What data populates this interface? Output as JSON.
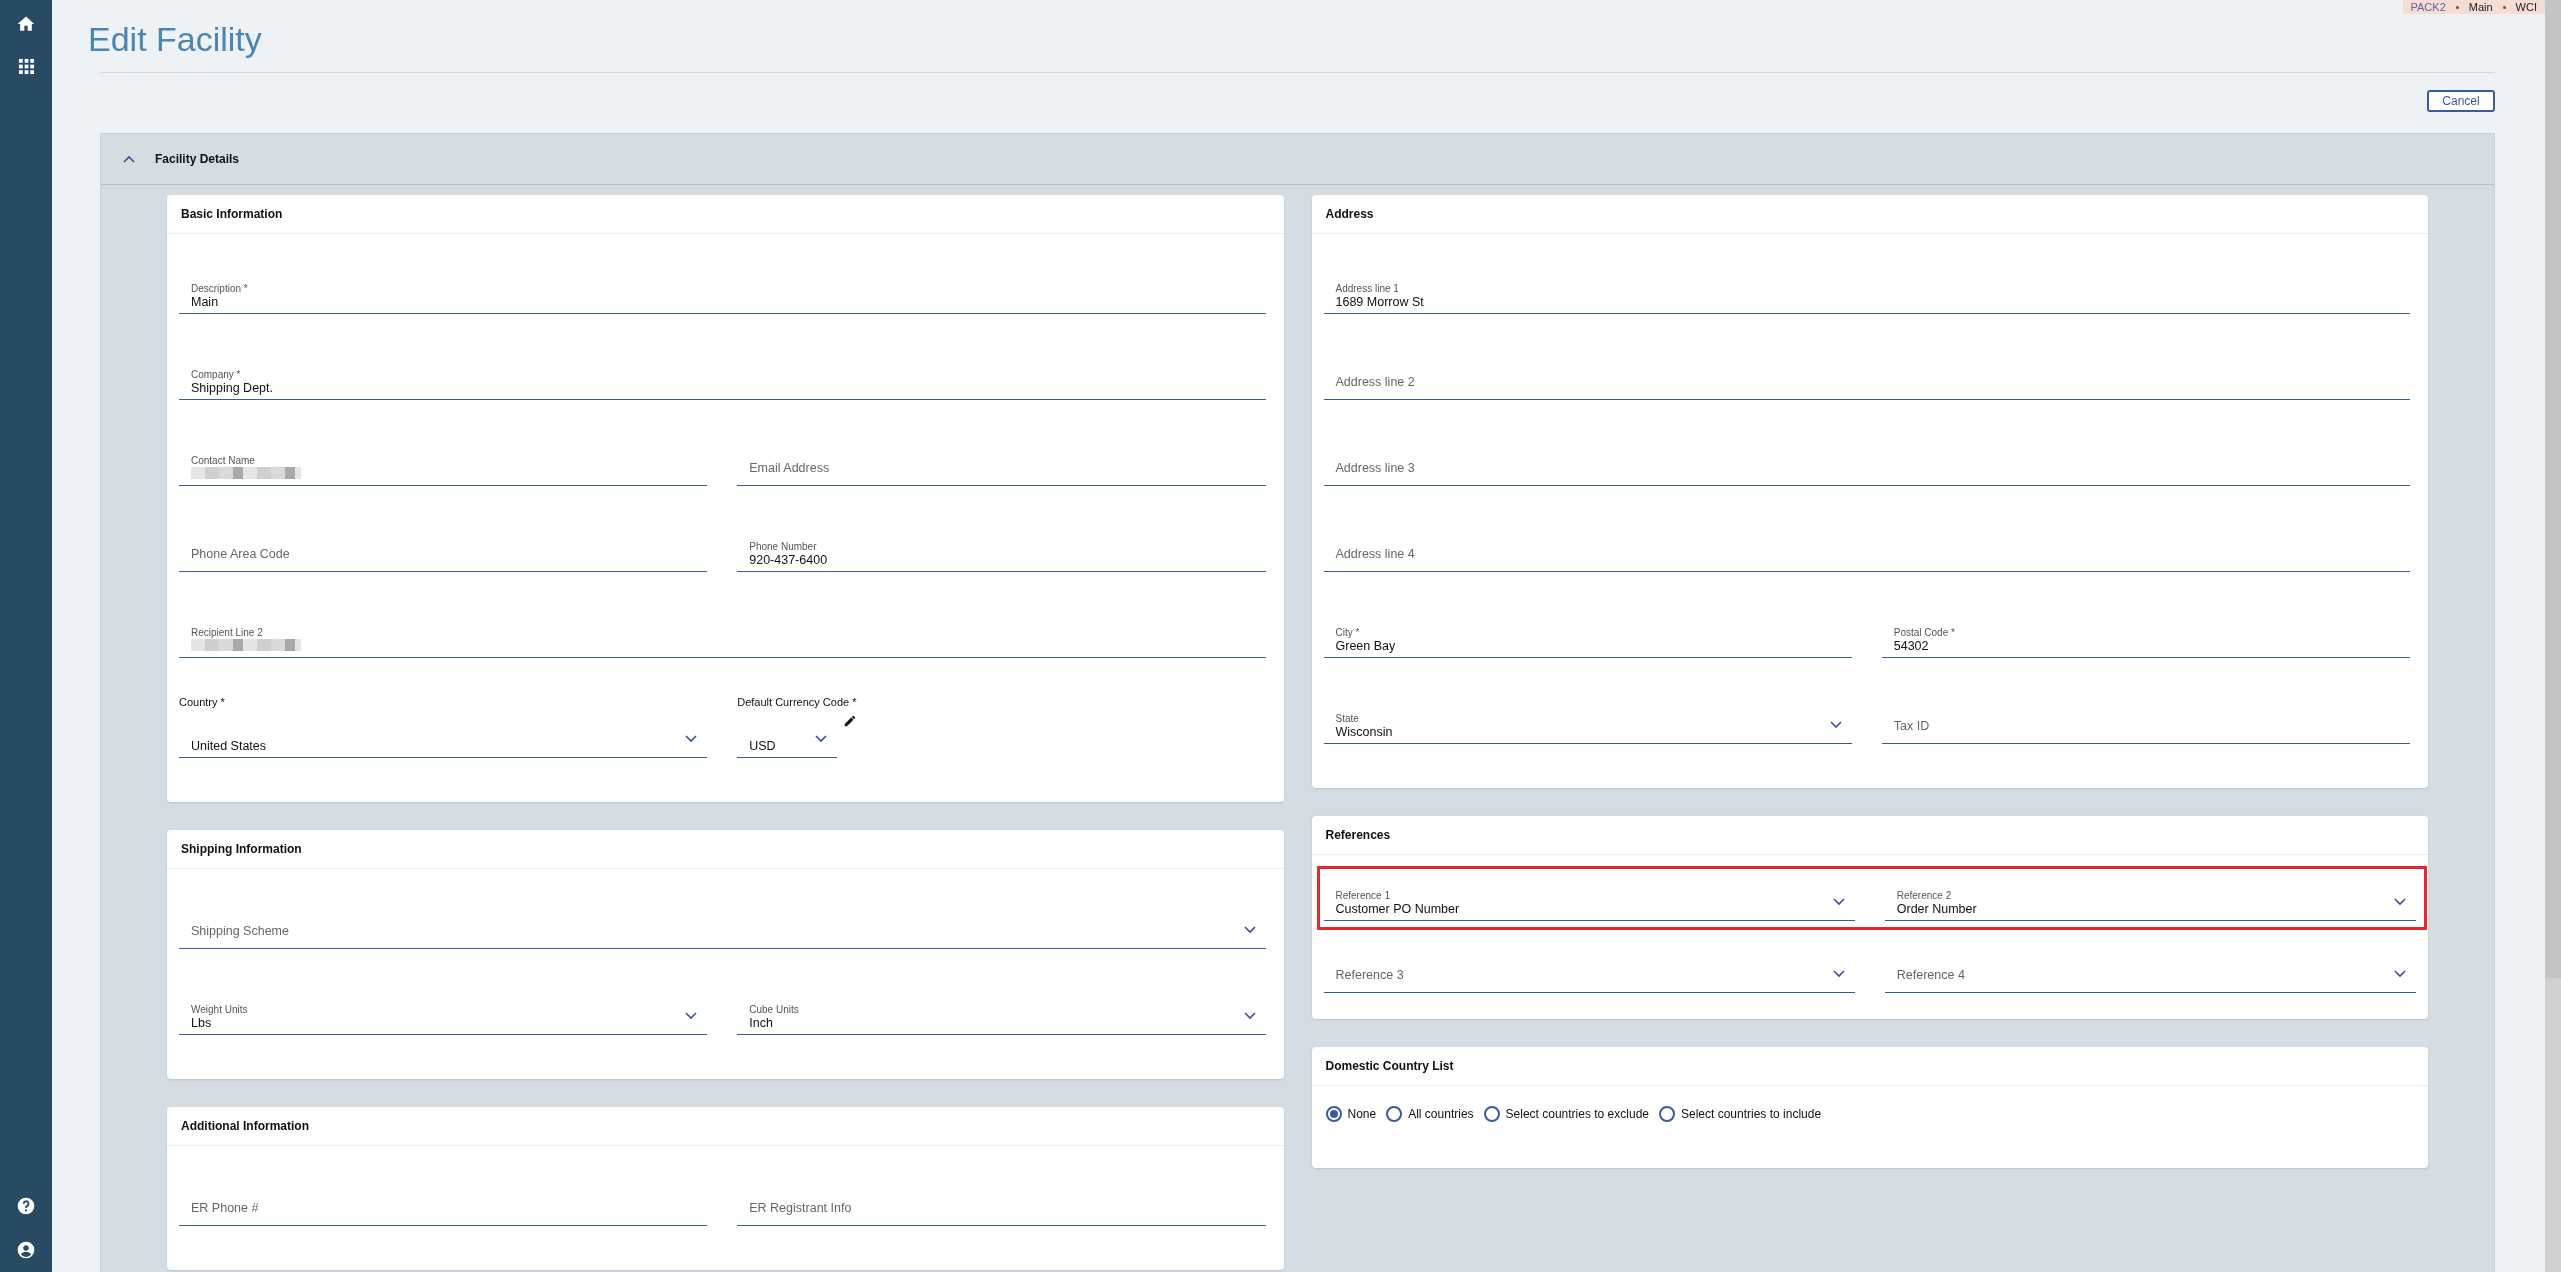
{
  "context": [
    "PACK2",
    "Main",
    "WCI"
  ],
  "page": {
    "title": "Edit Facility",
    "cancel": "Cancel"
  },
  "panel": {
    "title": "Facility Details",
    "expanded": true
  },
  "left_cards": [
    {
      "title": "Basic Information",
      "rows": [
        [
          {
            "kind": "text",
            "label": "Description *",
            "value": "Main"
          }
        ],
        [
          {
            "kind": "text",
            "label": "Company *",
            "value": "Shipping Dept."
          }
        ],
        [
          {
            "kind": "text",
            "label": "Contact Name",
            "redacted": true
          },
          {
            "kind": "text",
            "placeholder": "Email Address"
          }
        ],
        [
          {
            "kind": "text",
            "placeholder": "Phone Area Code"
          },
          {
            "kind": "text",
            "label": "Phone Number",
            "value": "920-437-6400"
          }
        ],
        [
          {
            "kind": "text",
            "label": "Recipient Line 2",
            "redacted": true
          }
        ],
        [
          {
            "kind": "outside-select",
            "label": "Country *",
            "value": "United States"
          },
          {
            "kind": "short-select",
            "label": "Default Currency Code *",
            "value": "USD",
            "editable": true
          }
        ]
      ]
    },
    {
      "title": "Shipping Information",
      "rows": [
        [
          {
            "kind": "select",
            "placeholder": "Shipping Scheme"
          }
        ],
        [
          {
            "kind": "select",
            "label": "Weight Units",
            "value": "Lbs"
          },
          {
            "kind": "select",
            "label": "Cube Units",
            "value": "Inch"
          }
        ]
      ]
    },
    {
      "title": "Additional Information",
      "rows": [
        [
          {
            "kind": "text",
            "placeholder": "ER Phone #"
          },
          {
            "kind": "text",
            "placeholder": "ER Registrant Info"
          }
        ]
      ]
    }
  ],
  "right_cards": [
    {
      "title": "Address",
      "rows": [
        [
          {
            "kind": "text",
            "label": "Address line 1",
            "value": "1689 Morrow St"
          }
        ],
        [
          {
            "kind": "text",
            "placeholder": "Address line 2"
          }
        ],
        [
          {
            "kind": "text",
            "placeholder": "Address line 3"
          }
        ],
        [
          {
            "kind": "text",
            "placeholder": "Address line 4"
          }
        ],
        [
          {
            "kind": "text",
            "label": "City *",
            "value": "Green Bay"
          },
          {
            "kind": "text",
            "label": "Postal Code *",
            "value": "54302"
          }
        ],
        [
          {
            "kind": "select",
            "label": "State",
            "value": "Wisconsin"
          },
          {
            "kind": "text",
            "placeholder": "Tax ID"
          }
        ]
      ]
    },
    {
      "title": "References",
      "tight": true,
      "rows": [
        [
          {
            "kind": "select",
            "label": "Reference 1",
            "value": "Customer PO Number"
          },
          {
            "kind": "select",
            "label": "Reference 2",
            "value": "Order Number"
          }
        ],
        [
          {
            "kind": "select",
            "placeholder": "Reference 3"
          },
          {
            "kind": "select",
            "placeholder": "Reference 4"
          }
        ]
      ],
      "highlighted_row": true
    },
    {
      "title": "Domestic Country List",
      "radios": [
        {
          "label": "None",
          "selected": true
        },
        {
          "label": "All countries",
          "selected": false
        },
        {
          "label": "Select countries to exclude",
          "selected": false
        },
        {
          "label": "Select countries to include",
          "selected": false
        }
      ]
    }
  ]
}
